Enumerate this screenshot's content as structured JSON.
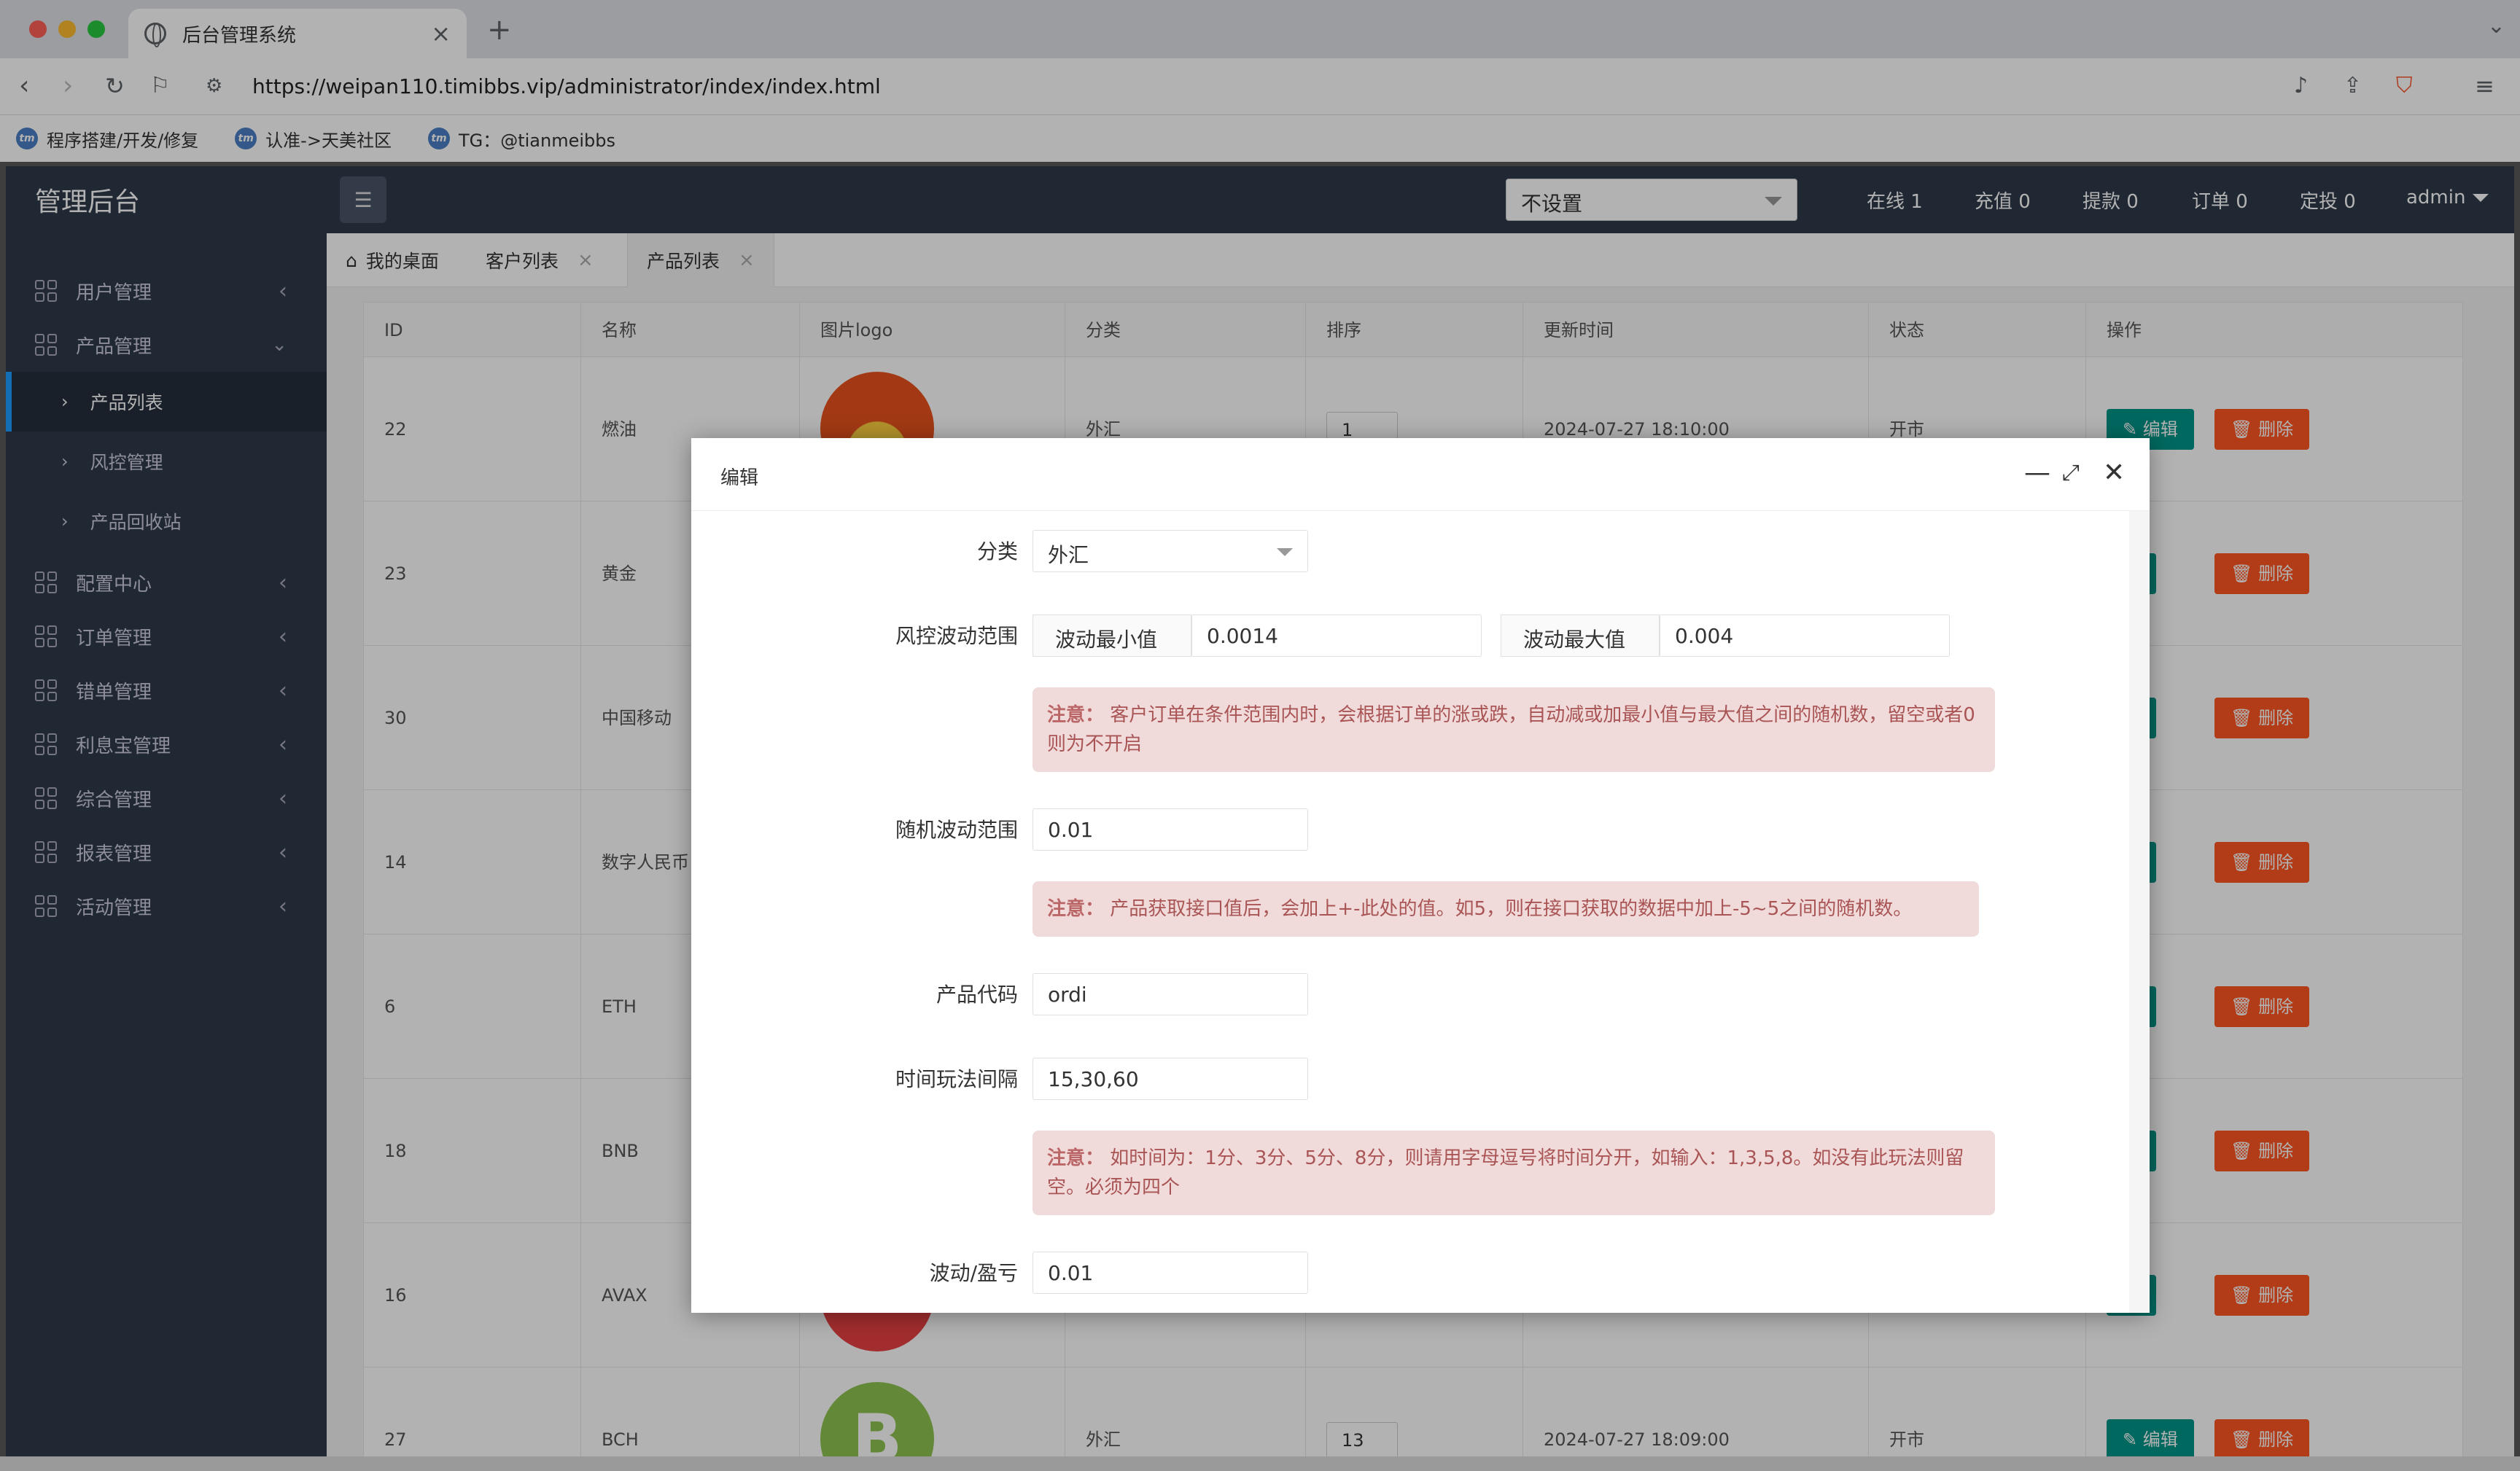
{
  "browser": {
    "tab_title": "后台管理系统",
    "url": "https://weipan110.timibbs.vip/administrator/index/index.html",
    "bookmarks": [
      {
        "label": "程序搭建/开发/修复"
      },
      {
        "label": "认准->天美社区"
      },
      {
        "label": "TG：@tianmeibbs"
      }
    ]
  },
  "app": {
    "logo": "管理后台",
    "top_select": "不设置",
    "stats": {
      "online": "在线 1",
      "recharge": "充值 0",
      "withdraw": "提款 0",
      "orders": "订单 0",
      "fixed": "定投 0",
      "user": "admin"
    }
  },
  "sidebar": {
    "items": [
      {
        "label": "用户管理"
      },
      {
        "label": "产品管理"
      },
      {
        "label": "配置中心"
      },
      {
        "label": "订单管理"
      },
      {
        "label": "错单管理"
      },
      {
        "label": "利息宝管理"
      },
      {
        "label": "综合管理"
      },
      {
        "label": "报表管理"
      },
      {
        "label": "活动管理"
      }
    ],
    "sub_items": [
      {
        "label": "产品列表"
      },
      {
        "label": "风控管理"
      },
      {
        "label": "产品回收站"
      }
    ]
  },
  "page_tabs": [
    {
      "label": "我的桌面"
    },
    {
      "label": "客户列表"
    },
    {
      "label": "产品列表"
    }
  ],
  "table": {
    "headers": [
      "ID",
      "名称",
      "图片logo",
      "分类",
      "排序",
      "更新时间",
      "状态",
      "操作"
    ],
    "rows": [
      {
        "id": "22",
        "name": "燃油",
        "category": "外汇",
        "sort": "1",
        "updated": "2024-07-27 18:10:00",
        "status": "开市"
      },
      {
        "id": "23",
        "name": "黄金",
        "category": "",
        "sort": "",
        "updated": "",
        "status": ""
      },
      {
        "id": "30",
        "name": "中国移动",
        "category": "",
        "sort": "",
        "updated": "",
        "status": ""
      },
      {
        "id": "14",
        "name": "数字人民币",
        "category": "",
        "sort": "",
        "updated": "",
        "status": ""
      },
      {
        "id": "6",
        "name": "ETH",
        "category": "",
        "sort": "",
        "updated": "",
        "status": ""
      },
      {
        "id": "18",
        "name": "BNB",
        "category": "",
        "sort": "",
        "updated": "",
        "status": ""
      },
      {
        "id": "16",
        "name": "AVAX",
        "category": "",
        "sort": "",
        "updated": "",
        "status": ""
      },
      {
        "id": "27",
        "name": "BCH",
        "category": "外汇",
        "sort": "13",
        "updated": "2024-07-27 18:09:00",
        "status": "开市"
      }
    ],
    "edit_label": "✎ 编辑",
    "edit_label_clipped": "辑",
    "delete_label": "🗑 删除"
  },
  "modal": {
    "title": "编辑",
    "fields": {
      "category_label": "分类",
      "category_value": "外汇",
      "risk_label": "风控波动范围",
      "min_addon": "波动最小值",
      "min_value": "0.0014",
      "max_addon": "波动最大值",
      "max_value": "0.004",
      "risk_note_head": "注意：",
      "risk_note": "客户订单在条件范围内时，会根据订单的涨或跌，自动减或加最小值与最大值之间的随机数，留空或者0则为不开启",
      "random_label": "随机波动范围",
      "random_value": "0.01",
      "random_note_head": "注意：",
      "random_note": "产品获取接口值后，会加上+-此处的值。如5，则在接口获取的数据中加上-5~5之间的随机数。",
      "code_label": "产品代码",
      "code_value": "ordi",
      "interval_label": "时间玩法间隔",
      "interval_value": "15,30,60",
      "interval_note_head": "注意：",
      "interval_note": "如时间为：1分、3分、5分、8分，则请用字母逗号将时间分开，如输入：1,3,5,8。如没有此玩法则留空。必须为四个",
      "profit_label": "波动/盈亏",
      "profit_value": "0.01"
    }
  },
  "colors": {
    "sidebar_bg": "#2f3a4b",
    "edit_btn": "#009688",
    "delete_btn": "#ff5722",
    "accent": "#1e9fff",
    "note_bg": "#f0dada"
  }
}
